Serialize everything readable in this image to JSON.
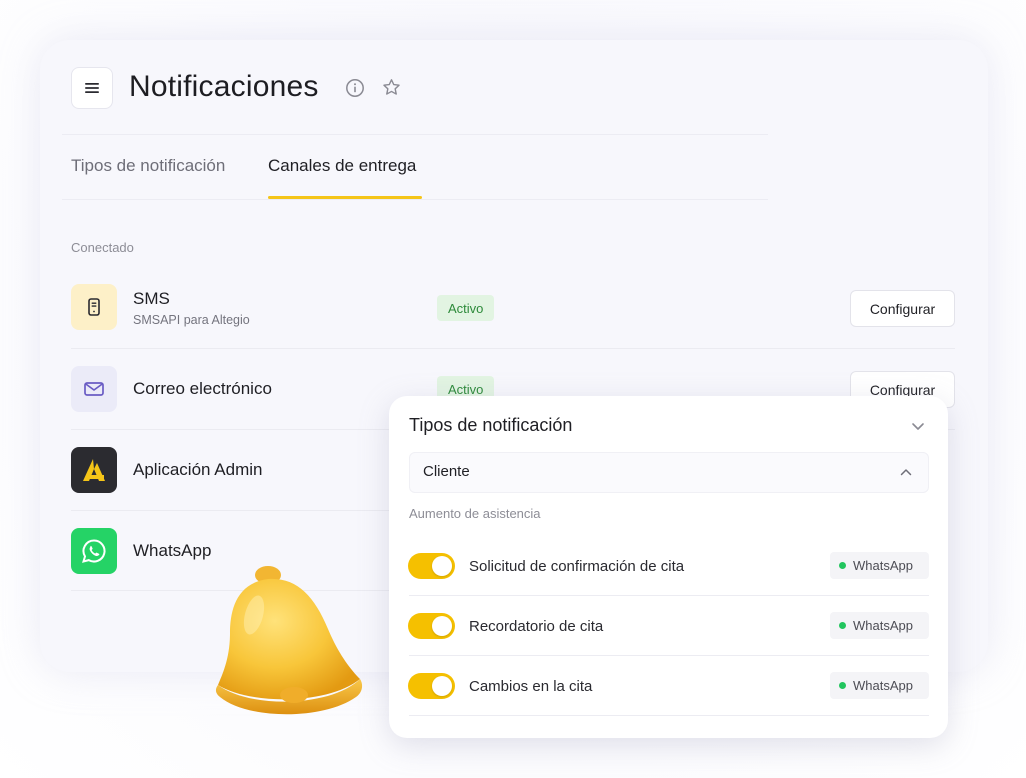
{
  "header": {
    "title": "Notificaciones",
    "icons": {
      "menu": "menu-icon",
      "info": "info-icon",
      "favorite": "star-icon"
    }
  },
  "tabs": [
    {
      "label": "Tipos de notificación",
      "active": false
    },
    {
      "label": "Canales de entrega",
      "active": true
    }
  ],
  "section_label": "Conectado",
  "channels": [
    {
      "name": "SMS",
      "subtitle": "SMSAPI para Altegio",
      "status": "Activo",
      "action": "Configurar",
      "icon": "phone-icon"
    },
    {
      "name": "Correo electrónico",
      "subtitle": "",
      "status": "Activo",
      "action": "Configurar",
      "icon": "mail-icon"
    },
    {
      "name": "Aplicación Admin",
      "icon": "altegio-logo-icon"
    },
    {
      "name": "WhatsApp",
      "icon": "whatsapp-icon"
    }
  ],
  "panel": {
    "title": "Tipos de notificación",
    "select_value": "Cliente",
    "group_label": "Aumento de asistencia",
    "items": [
      {
        "label": "Solicitud de confirmación de cita",
        "enabled": true,
        "channel": "WhatsApp"
      },
      {
        "label": "Recordatorio de cita",
        "enabled": true,
        "channel": "WhatsApp"
      },
      {
        "label": "Cambios en la cita",
        "enabled": true,
        "channel": "WhatsApp"
      }
    ]
  },
  "colors": {
    "accent": "#f5c518",
    "toggle_on": "#f5c000",
    "active_badge_bg": "#e2f4e2",
    "active_badge_text": "#2d8a3a",
    "whatsapp": "#25d366",
    "admin_app_bg": "#2b2b30"
  }
}
